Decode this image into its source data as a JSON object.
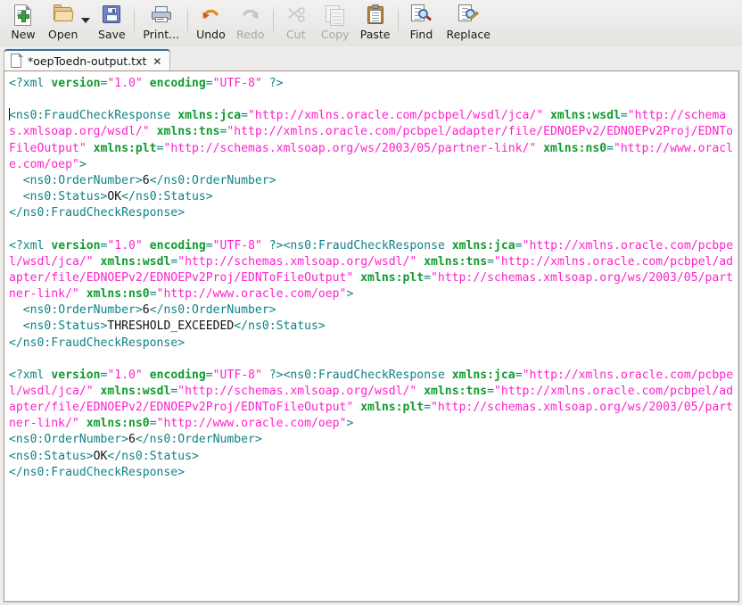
{
  "window": {
    "title": "*oepToedn-output.txt"
  },
  "toolbar": {
    "items": [
      {
        "label": "New",
        "icon": "new-document-icon",
        "enabled": true
      },
      {
        "label": "Open",
        "icon": "open-folder-icon",
        "enabled": true
      },
      {
        "label": "Save",
        "icon": "save-floppy-icon",
        "enabled": true
      },
      {
        "label": "Print...",
        "icon": "printer-icon",
        "enabled": true
      },
      {
        "label": "Undo",
        "icon": "undo-arrow-icon",
        "enabled": true
      },
      {
        "label": "Redo",
        "icon": "redo-arrow-icon",
        "enabled": false
      },
      {
        "label": "Cut",
        "icon": "scissors-icon",
        "enabled": false
      },
      {
        "label": "Copy",
        "icon": "copy-pages-icon",
        "enabled": false
      },
      {
        "label": "Paste",
        "icon": "clipboard-icon",
        "enabled": true
      },
      {
        "label": "Find",
        "icon": "find-magnifier-icon",
        "enabled": true
      },
      {
        "label": "Replace",
        "icon": "replace-magnifier-pencil-icon",
        "enabled": true
      }
    ]
  },
  "tab": {
    "label": "*oepToedn-output.txt",
    "close": "✕",
    "icon": "text-file-icon"
  },
  "colors": {
    "tag": "#0f8286",
    "attribute_name": "#0f9b2e",
    "attribute_value": "#ff20cc",
    "text_content": "#111111",
    "editor_background": "#ffffff",
    "toolbar_background": "#eceae8",
    "tab_active_top": "#3a6ea5",
    "editor_border": "#a08f83"
  },
  "editor": {
    "filename": "oepToedn-output.txt",
    "modified": true,
    "documents": [
      {
        "declaration": "<?xml version=\"1.0\" encoding=\"UTF-8\" ?>",
        "root_element": "ns0:FraudCheckResponse",
        "namespaces": {
          "xmlns:jca": "http://xmlns.oracle.com/pcbpel/wsdl/jca/",
          "xmlns:wsdl": "http://schemas.xmlsoap.org/wsdl/",
          "xmlns:tns": "http://xmlns.oracle.com/pcbpel/adapter/file/EDNOEPv2/EDNOEPv2Proj/EDNToFileOutput",
          "xmlns:plt": "http://schemas.xmlsoap.org/ws/2003/05/partner-link/",
          "xmlns:ns0": "http://www.oracle.com/oep"
        },
        "fields": [
          {
            "name": "ns0:OrderNumber",
            "value": "6"
          },
          {
            "name": "ns0:Status",
            "value": "OK"
          }
        ],
        "declaration_on_own_line": true,
        "indented": true
      },
      {
        "declaration": "<?xml version=\"1.0\" encoding=\"UTF-8\" ?>",
        "root_element": "ns0:FraudCheckResponse",
        "namespaces": {
          "xmlns:jca": "http://xmlns.oracle.com/pcbpel/wsdl/jca/",
          "xmlns:wsdl": "http://schemas.xmlsoap.org/wsdl/",
          "xmlns:tns": "http://xmlns.oracle.com/pcbpel/adapter/file/EDNOEPv2/EDNOEPv2Proj/EDNToFileOutput",
          "xmlns:plt": "http://schemas.xmlsoap.org/ws/2003/05/partner-link/",
          "xmlns:ns0": "http://www.oracle.com/oep"
        },
        "fields": [
          {
            "name": "ns0:OrderNumber",
            "value": "6"
          },
          {
            "name": "ns0:Status",
            "value": "THRESHOLD_EXCEEDED"
          }
        ],
        "declaration_on_own_line": false,
        "indented": true
      },
      {
        "declaration": "<?xml version=\"1.0\" encoding=\"UTF-8\" ?>",
        "root_element": "ns0:FraudCheckResponse",
        "namespaces": {
          "xmlns:jca": "http://xmlns.oracle.com/pcbpel/wsdl/jca/",
          "xmlns:wsdl": "http://schemas.xmlsoap.org/wsdl/",
          "xmlns:tns": "http://xmlns.oracle.com/pcbpel/adapter/file/EDNOEPv2/EDNOEPv2Proj/EDNToFileOutput",
          "xmlns:plt": "http://schemas.xmlsoap.org/ws/2003/05/partner-link/",
          "xmlns:ns0": "http://www.oracle.com/oep"
        },
        "fields": [
          {
            "name": "ns0:OrderNumber",
            "value": "6"
          },
          {
            "name": "ns0:Status",
            "value": "OK"
          }
        ],
        "declaration_on_own_line": false,
        "indented": false
      }
    ]
  }
}
